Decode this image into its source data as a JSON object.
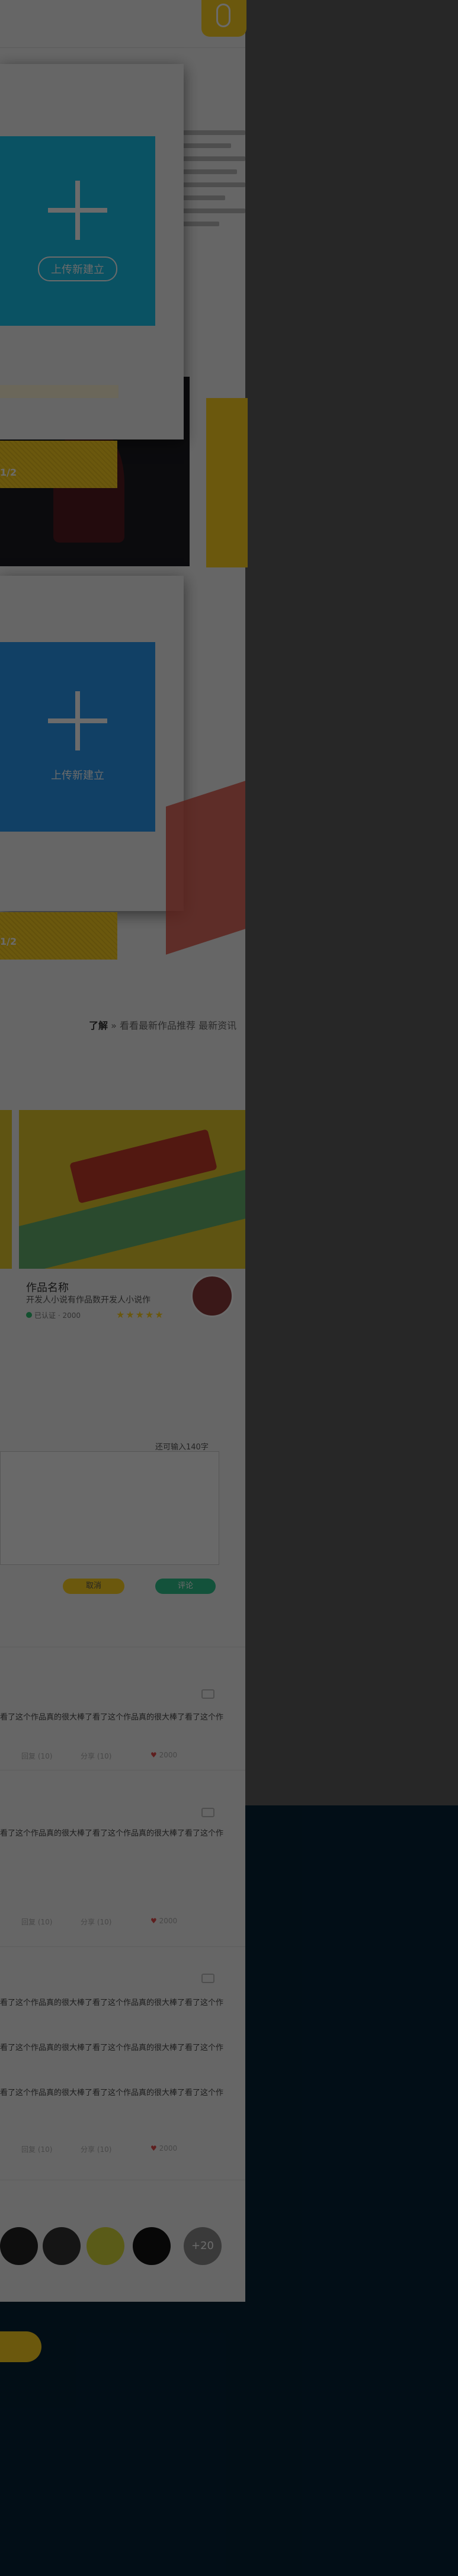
{
  "header": {
    "mic_icon": "microphone-icon"
  },
  "slides": [
    {
      "upload_label": "上传新建立",
      "tile_color": "#19c3ec",
      "page": "1/2"
    },
    {
      "upload_label": "上传新建立",
      "tile_color": "#2a9af0",
      "page": "1/2"
    }
  ],
  "breadcrumb": {
    "current": "了解",
    "rest": "» 看看最新作品推荐 最新资讯"
  },
  "work": {
    "title": "作品名称",
    "description": "开发人小说有作品数开发人小说作",
    "meta": "已认证 · 2000",
    "rating": "★★★★★"
  },
  "comment_form": {
    "counter": "还可输入140字",
    "cancel_label": "取消",
    "submit_label": "评论"
  },
  "comments": [
    {
      "text": "看了这个作品真的很大棒了看了这个作品真的很大棒了看了这个作",
      "reply": "回复 (10)",
      "share": "分享 (10)",
      "likes": "2000"
    },
    {
      "text": "看了这个作品真的很大棒了看了这个作品真的很大棒了看了这个作",
      "reply": "回复 (10)",
      "share": "分享 (10)",
      "likes": "2000"
    },
    {
      "text": "看了这个作品真的很大棒了看了这个作品真的很大棒了看了这个作",
      "text2": "看了这个作品真的很大棒了看了这个作品真的很大棒了看了这个作",
      "text3": "看了这个作品真的很大棒了看了这个作品真的很大棒了看了这个作",
      "reply": "回复 (10)",
      "share": "分享 (10)",
      "likes": "2000"
    }
  ],
  "fans": {
    "more_label": "+20"
  },
  "colors": {
    "accent_yellow": "#ffd21f",
    "navy": "#052236",
    "cyan": "#19c3ec",
    "blue": "#2a9af0",
    "green": "#2fc48d"
  }
}
